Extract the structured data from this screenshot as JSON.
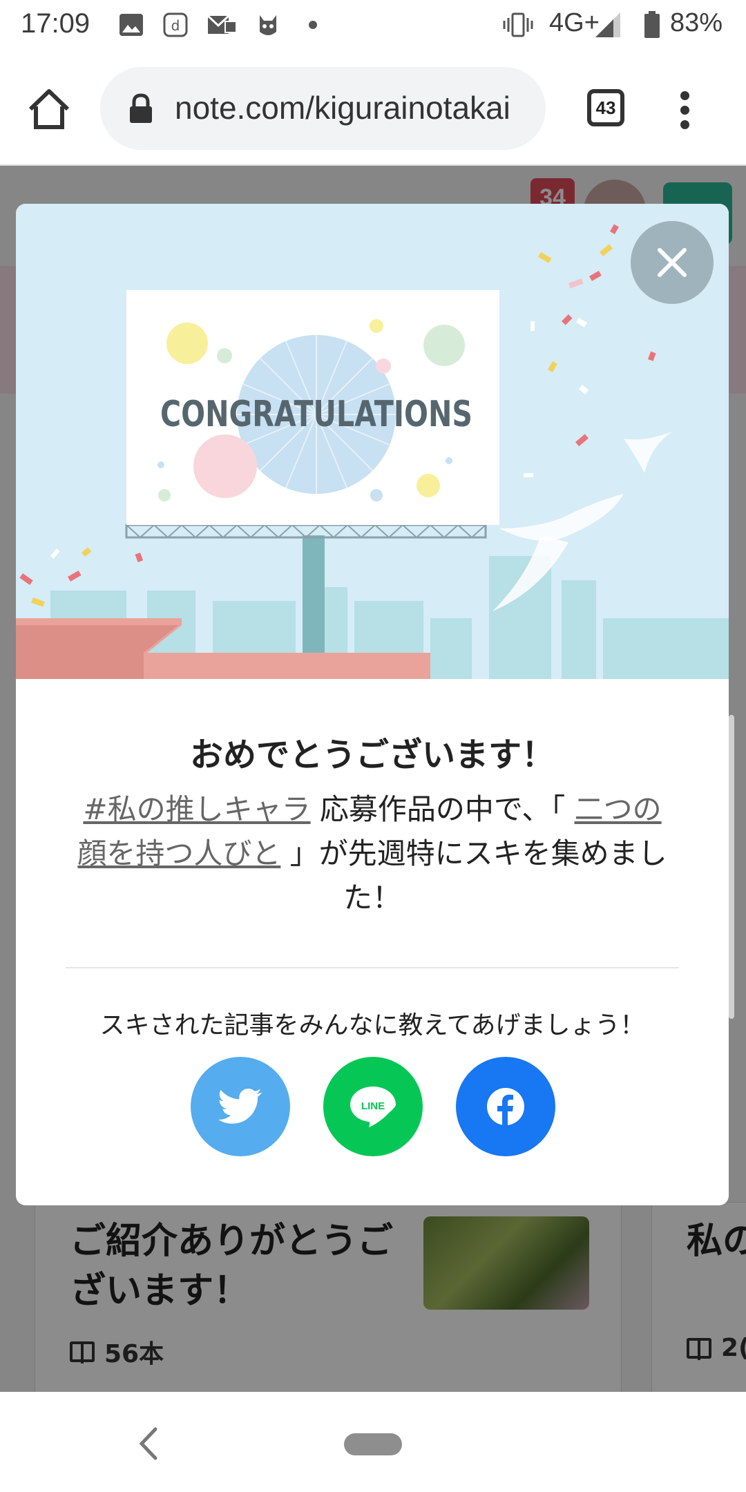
{
  "status_bar": {
    "time": "17:09",
    "network": "4G+",
    "battery": "83%"
  },
  "browser": {
    "url": "note.com/kigurainotakai",
    "tab_count": "43"
  },
  "page_bg": {
    "notification_count": "34",
    "card1": {
      "title": "ご紹介ありがとうございます！",
      "count": "56本"
    },
    "card2": {
      "title": "私の合い",
      "count": "2("
    }
  },
  "modal": {
    "banner_text": "CONGRATULATIONS",
    "title": "おめでとうございます！",
    "desc_hashtag": "#私の推しキャラ",
    "desc_part1": " 応募作品の中で、「 ",
    "desc_article": "二つの顔を持つ人びと",
    "desc_part2": " 」が先週特にスキを集めました！",
    "share_prompt": "スキされた記事をみんなに教えてあげましょう！",
    "share_buttons": [
      {
        "name": "twitter",
        "icon": "twitter-bird-icon",
        "color": "#55acee"
      },
      {
        "name": "line",
        "label": "LINE",
        "color": "#06c755"
      },
      {
        "name": "facebook",
        "icon": "facebook-f-icon",
        "color": "#1877f2"
      }
    ]
  }
}
